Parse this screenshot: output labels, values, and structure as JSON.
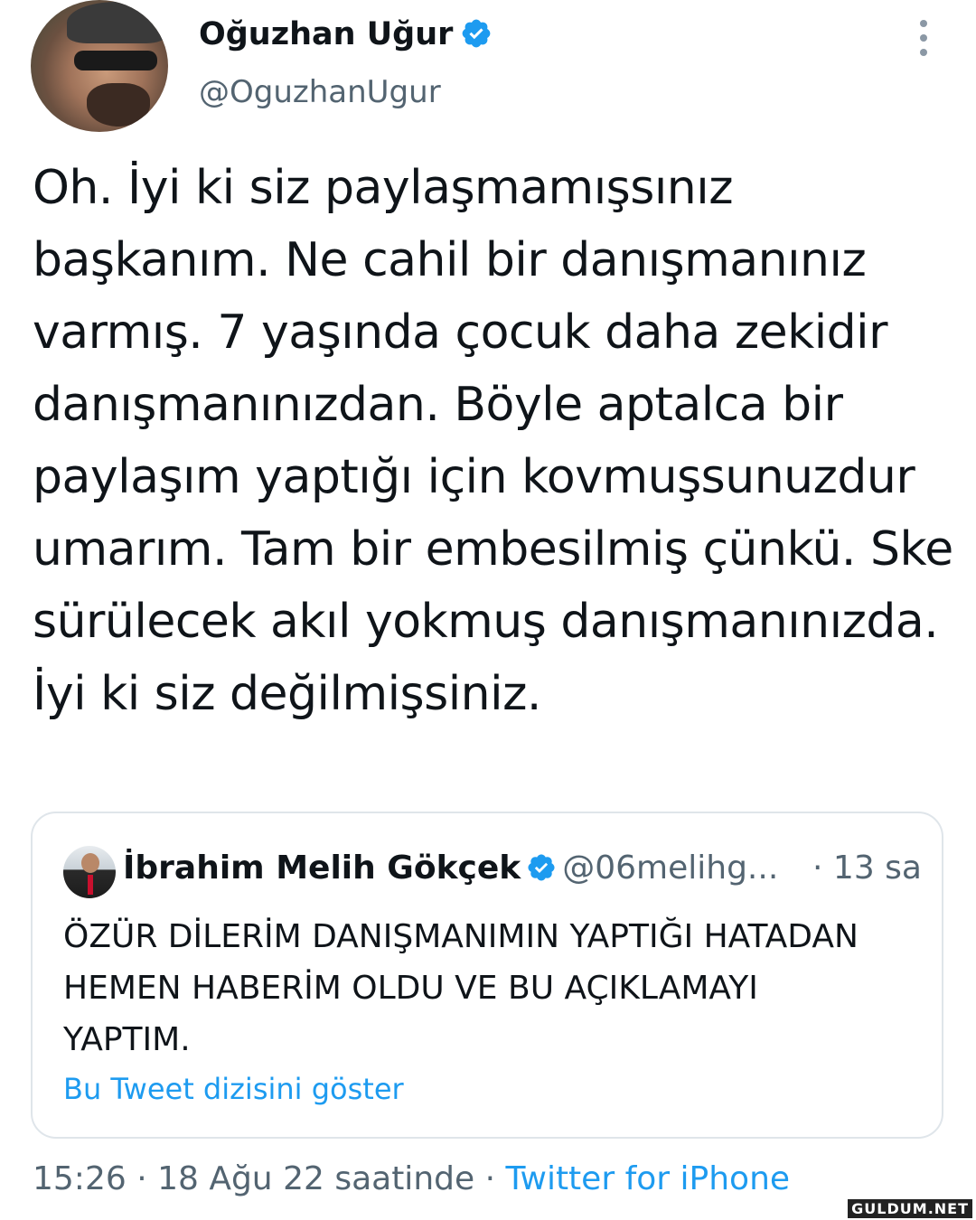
{
  "author": {
    "name": "Oğuzhan Uğur",
    "handle": "@OguzhanUgur",
    "verified_icon": "verified-badge-icon",
    "avatar_icon": "avatar-photo"
  },
  "tweet": {
    "text": "Oh. İyi ki siz paylaşmamışsınız başkanım. Ne cahil bir danışmanınız varmış. 7 yaşında çocuk daha zekidir danışmanınızdan. Böyle aptalca bir paylaşım yaptığı için kovmuşsunuzdur umarım. Tam bir embesilmiş çünkü. Ske sürülecek akıl yokmuş danışmanınızda. İyi ki siz değilmişsiniz."
  },
  "quoted": {
    "name": "İbrahim Melih Gökçek",
    "handle": "@06melihg...",
    "time": "· 13 sa",
    "text": "ÖZÜR DİLERİM DANIŞMANIMIN YAPTIĞI HATADAN HEMEN HABERİM OLDU VE BU AÇIKLAMAYI YAPTIM.",
    "thread_link": "Bu Tweet dizisini göster"
  },
  "meta": {
    "timestamp": "15:26 · 18 Ağu 22 saatinde ·",
    "source": "Twitter for iPhone"
  },
  "watermark": "GULDUM.NET",
  "colors": {
    "accent": "#1d9bf0",
    "secondary_text": "#536471",
    "primary_text": "#0f1419",
    "border": "#dfe5ea"
  }
}
